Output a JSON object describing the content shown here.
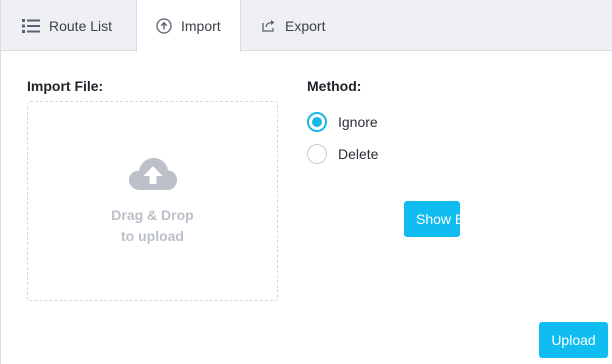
{
  "tabs": [
    {
      "label": "Route List",
      "icon": "list-icon"
    },
    {
      "label": "Import",
      "icon": "upload-circle-icon"
    },
    {
      "label": "Export",
      "icon": "share-export-icon"
    }
  ],
  "active_tab": "Import",
  "import_file": {
    "label": "Import File:",
    "drop_line1": "Drag & Drop",
    "drop_line2": "to upload",
    "icon": "cloud-upload-icon"
  },
  "method": {
    "label": "Method:",
    "options": [
      {
        "label": "Ignore",
        "selected": true
      },
      {
        "label": "Delete",
        "selected": false
      }
    ]
  },
  "buttons": {
    "show": "Show E",
    "upload": "Upload"
  },
  "colors": {
    "accent": "#0fbdf0",
    "radio_selected": "#18b7e8",
    "tabbar_bg": "#eef0f4"
  }
}
